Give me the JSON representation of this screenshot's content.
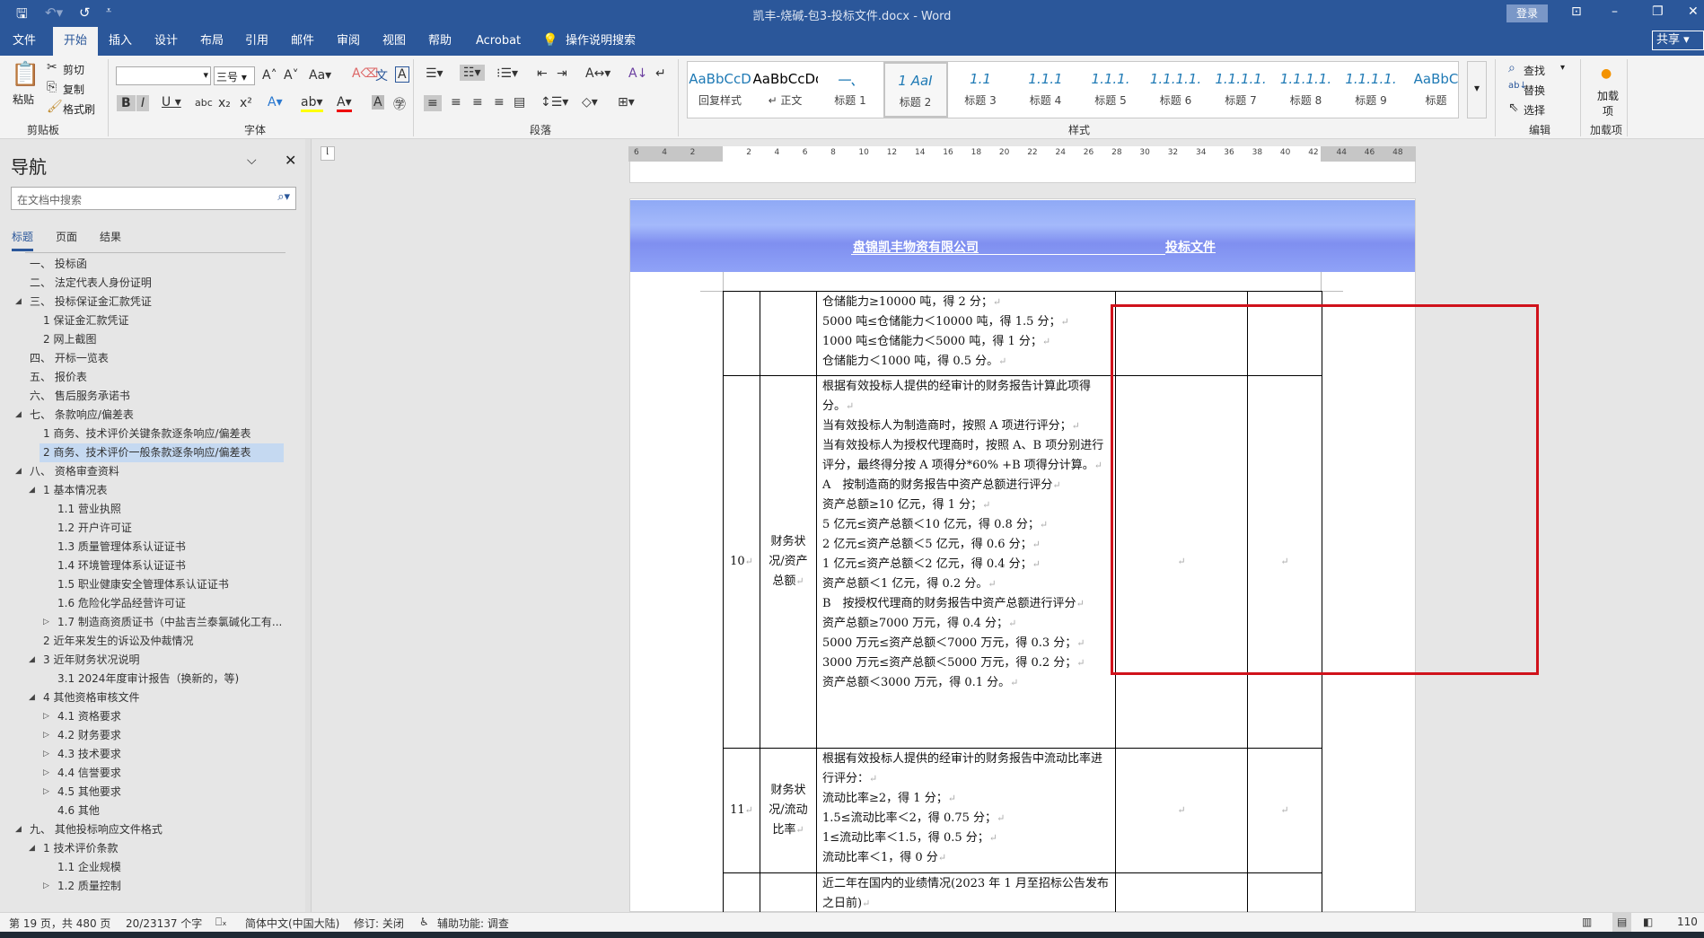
{
  "titlebar": {
    "title": "凯丰-烧碱-包3-投标文件.docx  -  Word",
    "login": "登录",
    "save_icon": "💾",
    "undo_icon": "↶",
    "redo_icon": "↺"
  },
  "tabs": [
    "文件",
    "开始",
    "插入",
    "设计",
    "布局",
    "引用",
    "邮件",
    "审阅",
    "视图",
    "帮助",
    "Acrobat"
  ],
  "tell_me": "操作说明搜索",
  "share": "共享",
  "ribbon": {
    "clipboard": {
      "paste": "粘贴",
      "cut": "剪切",
      "copy": "复制",
      "format_painter": "格式刷",
      "label": "剪贴板"
    },
    "font": {
      "font_name": "",
      "font_size": "三号",
      "label": "字体"
    },
    "paragraph": {
      "label": "段落"
    },
    "styles": {
      "label": "样式",
      "items": [
        {
          "preview": "AaBbCcD",
          "name": "回复样式"
        },
        {
          "preview": "AaBbCcDdI",
          "name": "↵ 正文"
        },
        {
          "preview": "一、",
          "name": "标题 1"
        },
        {
          "preview": "1 AaI",
          "name": "标题 2"
        },
        {
          "preview": "1.1",
          "name": "标题 3"
        },
        {
          "preview": "1.1.1",
          "name": "标题 4"
        },
        {
          "preview": "1.1.1.",
          "name": "标题 5"
        },
        {
          "preview": "1.1.1.1.",
          "name": "标题 6"
        },
        {
          "preview": "1.1.1.1.",
          "name": "标题 7"
        },
        {
          "preview": "1.1.1.1.",
          "name": "标题 8"
        },
        {
          "preview": "1.1.1.1.",
          "name": "标题 9"
        },
        {
          "preview": "AaBbC",
          "name": "标题"
        }
      ]
    },
    "editing": {
      "find": "查找",
      "replace": "替换",
      "select": "选择",
      "label": "编辑"
    },
    "addins": {
      "button": "加载项",
      "label": "加载项"
    }
  },
  "nav": {
    "title": "导航",
    "search_placeholder": "在文档中搜索",
    "tabs": [
      "标题",
      "页面",
      "结果"
    ],
    "items": [
      {
        "text": "一、 投标函",
        "level": 0,
        "exp": ""
      },
      {
        "text": "二、 法定代表人身份证明",
        "level": 0,
        "exp": ""
      },
      {
        "text": "三、 投标保证金汇款凭证",
        "level": 0,
        "exp": "open"
      },
      {
        "text": "1 保证金汇款凭证",
        "level": 1,
        "exp": ""
      },
      {
        "text": "2 网上截图",
        "level": 1,
        "exp": ""
      },
      {
        "text": "四、 开标一览表",
        "level": 0,
        "exp": ""
      },
      {
        "text": "五、 报价表",
        "level": 0,
        "exp": ""
      },
      {
        "text": "六、 售后服务承诺书",
        "level": 0,
        "exp": ""
      },
      {
        "text": "七、 条款响应/偏差表",
        "level": 0,
        "exp": "open"
      },
      {
        "text": "1 商务、技术评价关键条款逐条响应/偏差表",
        "level": 1,
        "exp": ""
      },
      {
        "text": "2 商务、技术评价一般条款逐条响应/偏差表",
        "level": 1,
        "exp": "",
        "selected": true
      },
      {
        "text": "八、 资格审查资料",
        "level": 0,
        "exp": "open"
      },
      {
        "text": "1 基本情况表",
        "level": 1,
        "exp": "open"
      },
      {
        "text": "1.1 营业执照",
        "level": 2,
        "exp": ""
      },
      {
        "text": "1.2 开户许可证",
        "level": 2,
        "exp": ""
      },
      {
        "text": "1.3 质量管理体系认证证书",
        "level": 2,
        "exp": ""
      },
      {
        "text": "1.4 环境管理体系认证证书",
        "level": 2,
        "exp": ""
      },
      {
        "text": "1.5 职业健康安全管理体系认证证书",
        "level": 2,
        "exp": ""
      },
      {
        "text": "1.6 危险化学品经营许可证",
        "level": 2,
        "exp": ""
      },
      {
        "text": "1.7 制造商资质证书（中盐吉兰泰氯碱化工有...",
        "level": 2,
        "exp": "closed"
      },
      {
        "text": "2 近年来发生的诉讼及仲裁情况",
        "level": 1,
        "exp": ""
      },
      {
        "text": "3 近年财务状况说明",
        "level": 1,
        "exp": "open"
      },
      {
        "text": "3.1 2024年度审计报告（换新的，等)",
        "level": 2,
        "exp": ""
      },
      {
        "text": "4 其他资格审核文件",
        "level": 1,
        "exp": "open"
      },
      {
        "text": "4.1 资格要求",
        "level": 2,
        "exp": "closed"
      },
      {
        "text": "4.2 财务要求",
        "level": 2,
        "exp": "closed"
      },
      {
        "text": "4.3 技术要求",
        "level": 2,
        "exp": "closed"
      },
      {
        "text": "4.4 信誉要求",
        "level": 2,
        "exp": "closed"
      },
      {
        "text": "4.5 其他要求",
        "level": 2,
        "exp": "closed"
      },
      {
        "text": "4.6 其他",
        "level": 2,
        "exp": ""
      },
      {
        "text": "九、 其他投标响应文件格式",
        "level": 0,
        "exp": "open"
      },
      {
        "text": "1 技术评价条款",
        "level": 1,
        "exp": "open"
      },
      {
        "text": "1.1 企业规模",
        "level": 2,
        "exp": ""
      },
      {
        "text": "1.2 质量控制",
        "level": 2,
        "exp": "closed"
      }
    ]
  },
  "ruler": [
    "6",
    "4",
    "2",
    "",
    "2",
    "4",
    "6",
    "8",
    "10",
    "12",
    "14",
    "16",
    "18",
    "20",
    "22",
    "24",
    "26",
    "28",
    "30",
    "32",
    "34",
    "36",
    "38",
    "40",
    "42",
    "44",
    "46",
    "48"
  ],
  "document": {
    "header_company": "盘锦凯丰物资有限公司",
    "header_title": "投标文件",
    "rows": [
      {
        "no": "",
        "item": "",
        "lines": [
          "仓储能力≥10000 吨，得 2 分；",
          "5000 吨≤仓储能力＜10000 吨，得 1.5 分；",
          "1000 吨≤仓储能力＜5000 吨，得 1 分；",
          "仓储能力＜1000 吨，得 0.5 分。"
        ]
      },
      {
        "no": "10",
        "item": "财务状况/资产总额",
        "lines": [
          "根据有效投标人提供的经审计的财务报告计算此项得分。",
          "当有效投标人为制造商时，按照 A 项进行评分；",
          "当有效投标人为授权代理商时，按照 A、B 项分别进行评分，最终得分按 A 项得分*60% +B 项得分计算。",
          "A　按制造商的财务报告中资产总额进行评分",
          "资产总额≥10 亿元，得 1 分；",
          "5 亿元≤资产总额＜10 亿元，得 0.8 分；",
          "2 亿元≤资产总额＜5 亿元，得 0.6 分；",
          "1 亿元≤资产总额＜2 亿元，得 0.4 分；",
          "资产总额＜1 亿元，得 0.2 分。",
          "B　按授权代理商的财务报告中资产总额进行评分",
          "资产总额≥7000 万元，得 0.4 分；",
          "5000 万元≤资产总额＜7000 万元，得 0.3 分；",
          "3000 万元≤资产总额＜5000 万元，得 0.2 分；",
          "资产总额＜3000 万元，得 0.1 分。"
        ]
      },
      {
        "no": "11",
        "item": "财务状况/流动比率",
        "lines": [
          "根据有效投标人提供的经审计的财务报告中流动比率进行评分：",
          "流动比率≥2，得 1 分；",
          "1.5≤流动比率＜2，得 0.75 分；",
          "1≤流动比率＜1.5，得 0.5 分；",
          "流动比率＜1，得 0 分"
        ]
      },
      {
        "no": "",
        "item": "",
        "lines": [
          "近二年在国内的业绩情况(2023 年 1 月至招标公告发布之日前)"
        ]
      }
    ]
  },
  "status": {
    "page": "第 19 页，共 480 页",
    "words": "20/23137 个字",
    "language": "简体中文(中国大陆)",
    "track": "修订: 关闭",
    "accessibility": "辅助功能: 调查",
    "zoom": "110"
  }
}
